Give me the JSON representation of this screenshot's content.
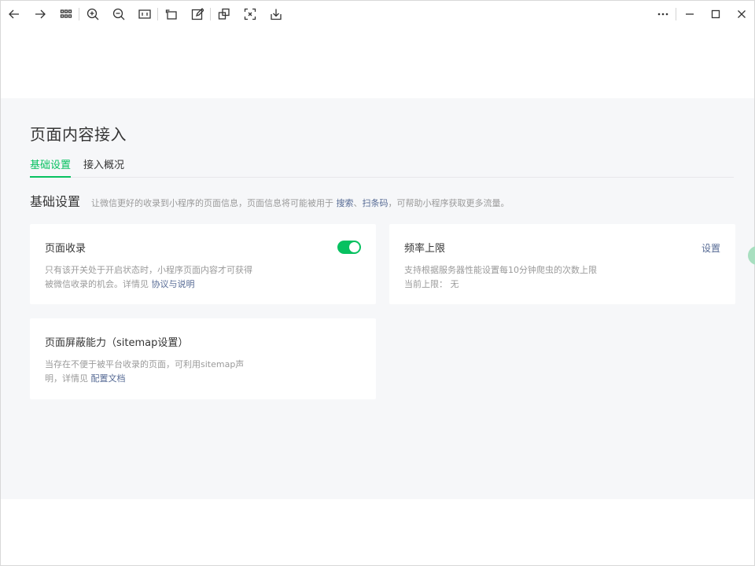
{
  "page": {
    "title": "页面内容接入",
    "tabs": [
      {
        "label": "基础设置",
        "active": true
      },
      {
        "label": "接入概况",
        "active": false
      }
    ]
  },
  "section": {
    "title": "基础设置",
    "desc_prefix": "让微信更好的收录到小程序的页面信息，页面信息将可能被用于",
    "link_search": "搜索",
    "separator": "、",
    "link_scan": "扫条码",
    "desc_suffix": "，可帮助小程序获取更多流量。"
  },
  "cards": {
    "page_index": {
      "title": "页面收录",
      "desc_line1": "只有该开关处于开启状态时，小程序页面内容才可获得",
      "desc_line2": "被微信收录的机会。详情见",
      "link": "协议与说明",
      "toggle_on": true
    },
    "rate_limit": {
      "title": "频率上限",
      "action": "设置",
      "desc_line1": "支持根据服务器性能设置每10分钟爬虫的次数上限",
      "current_label": "当前上限：",
      "current_value": "无"
    },
    "sitemap": {
      "title": "页面屏蔽能力（sitemap设置）",
      "desc_line1": "当存在不便于被平台收录的页面，可利用sitemap声",
      "desc_line2": "明，详情见",
      "link": "配置文档"
    }
  },
  "colors": {
    "accent": "#07c160",
    "link": "#576b95",
    "background": "#f6f7f9"
  }
}
